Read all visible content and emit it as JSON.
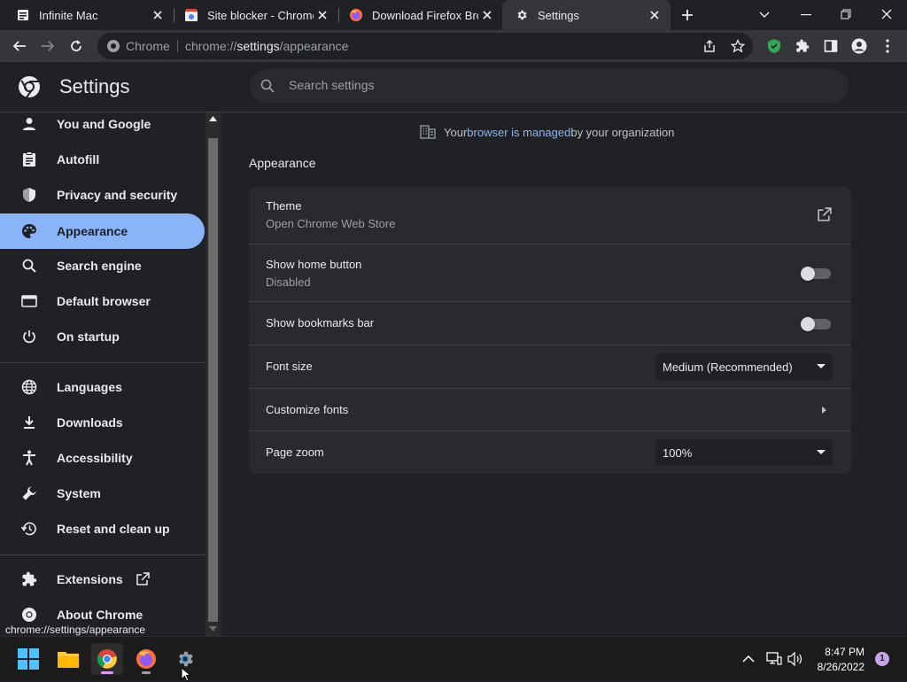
{
  "tabs": [
    {
      "title": "Infinite Mac",
      "favicon": "document-icon"
    },
    {
      "title": "Site blocker - Chrome Web Store",
      "favicon": "chrome-web-store-icon"
    },
    {
      "title": "Download Firefox Browser",
      "favicon": "firefox-icon"
    },
    {
      "title": "Settings",
      "favicon": "gear-icon",
      "active": true
    }
  ],
  "omnibox": {
    "site_label": "Chrome",
    "url_scheme": "chrome://",
    "url_host": "settings",
    "url_path": "/appearance"
  },
  "settings": {
    "title": "Settings",
    "search_placeholder": "Search settings"
  },
  "sidebar": {
    "items": [
      {
        "label": "You and Google",
        "icon": "person-icon"
      },
      {
        "label": "Autofill",
        "icon": "clipboard-icon"
      },
      {
        "label": "Privacy and security",
        "icon": "shield-icon"
      },
      {
        "label": "Appearance",
        "icon": "palette-icon",
        "selected": true
      },
      {
        "label": "Search engine",
        "icon": "search-icon"
      },
      {
        "label": "Default browser",
        "icon": "browser-window-icon"
      },
      {
        "label": "On startup",
        "icon": "power-icon"
      },
      {
        "label": "Languages",
        "icon": "globe-icon"
      },
      {
        "label": "Downloads",
        "icon": "download-icon"
      },
      {
        "label": "Accessibility",
        "icon": "accessibility-icon"
      },
      {
        "label": "System",
        "icon": "wrench-icon"
      },
      {
        "label": "Reset and clean up",
        "icon": "restore-icon"
      },
      {
        "label": "Extensions",
        "icon": "puzzle-icon"
      },
      {
        "label": "About Chrome",
        "icon": "chrome-icon"
      }
    ]
  },
  "managed": {
    "prefix": "Your ",
    "link": "browser is managed",
    "suffix": " by your organization"
  },
  "appearance": {
    "section_title": "Appearance",
    "theme_label": "Theme",
    "theme_sub": "Open Chrome Web Store",
    "home_button_label": "Show home button",
    "home_button_sub": "Disabled",
    "bookmarks_bar_label": "Show bookmarks bar",
    "font_size_label": "Font size",
    "font_size_value": "Medium (Recommended)",
    "customize_fonts_label": "Customize fonts",
    "page_zoom_label": "Page zoom",
    "page_zoom_value": "100%"
  },
  "status_bubble": "chrome://settings/appearance",
  "taskbar": {
    "time": "8:47 PM",
    "date": "8/26/2022",
    "notification_count": "1"
  },
  "colors": {
    "accent": "#8ab4f8",
    "background": "#202124",
    "card": "#292a2d",
    "toolbar": "#35363a",
    "shield_green": "#34a853"
  }
}
